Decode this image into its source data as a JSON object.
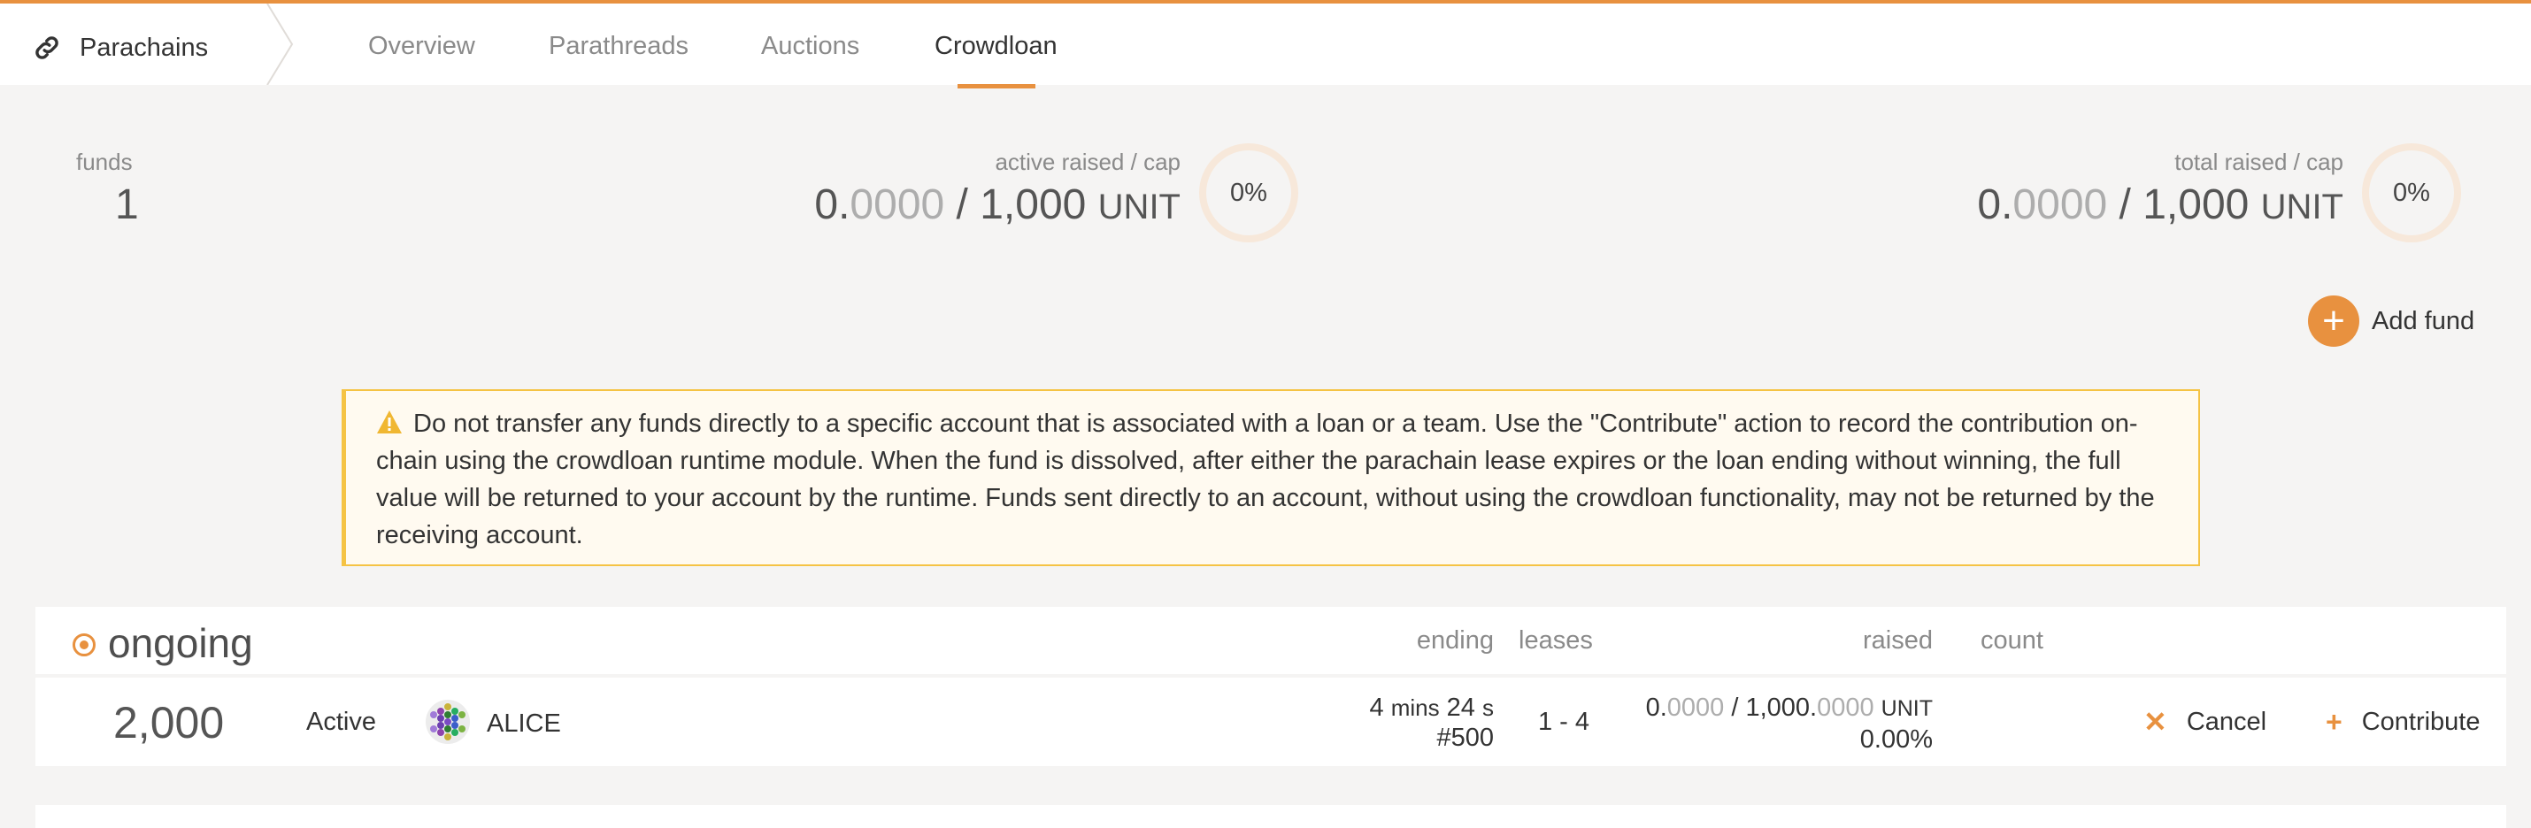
{
  "nav": {
    "app_title": "Parachains",
    "brand_icon": "link-icon",
    "tabs": [
      "Overview",
      "Parathreads",
      "Auctions",
      "Crowdloan"
    ],
    "active_tab": "Crowdloan"
  },
  "summary": {
    "funds_label": "funds",
    "funds_value": "1",
    "active_label": "active raised / cap",
    "active_value_int": "0.",
    "active_value_frac": "0000",
    "active_value_rest": " / 1,000 ",
    "active_unit": "UNIT",
    "active_percent": "0%",
    "total_label": "total raised / cap",
    "total_value_int": "0.",
    "total_value_frac": "0000",
    "total_value_rest": " / 1,000 ",
    "total_unit": "UNIT",
    "total_percent": "0%"
  },
  "actions": {
    "add_fund_label": "Add fund"
  },
  "warning": {
    "text": "Do not transfer any funds directly to a specific account that is associated with a loan or a team. Use the \"Contribute\" action to record the contribution on-chain using the crowdloan runtime module. When the fund is dissolved, after either the parachain lease expires or the loan ending without winning, the full value will be returned to your account by the runtime. Funds sent directly to an account, without using the crowdloan functionality, may not be returned by the receiving account."
  },
  "table": {
    "title": "ongoing",
    "headers": {
      "ending": "ending",
      "leases": "leases",
      "raised": "raised",
      "count": "count"
    },
    "rows": [
      {
        "fund_id": "2,000",
        "status": "Active",
        "depositor": "ALICE",
        "ending_mins_num": "4",
        "ending_mins_unit": "mins",
        "ending_secs_num": "24",
        "ending_secs_unit": "s",
        "ending_block": "#500",
        "leases": "1 - 4",
        "raised_int": "0.",
        "raised_frac": "0000",
        "raised_sep": " / ",
        "cap_int": "1,000.",
        "cap_frac": "0000",
        "raised_unit": "UNIT",
        "raised_percent": "0.00%",
        "count": "",
        "cancel_label": "Cancel",
        "contribute_label": "Contribute"
      }
    ]
  },
  "colors": {
    "accent": "#e8913f",
    "warning_border": "#f5c344",
    "background": "#f5f4f3"
  }
}
